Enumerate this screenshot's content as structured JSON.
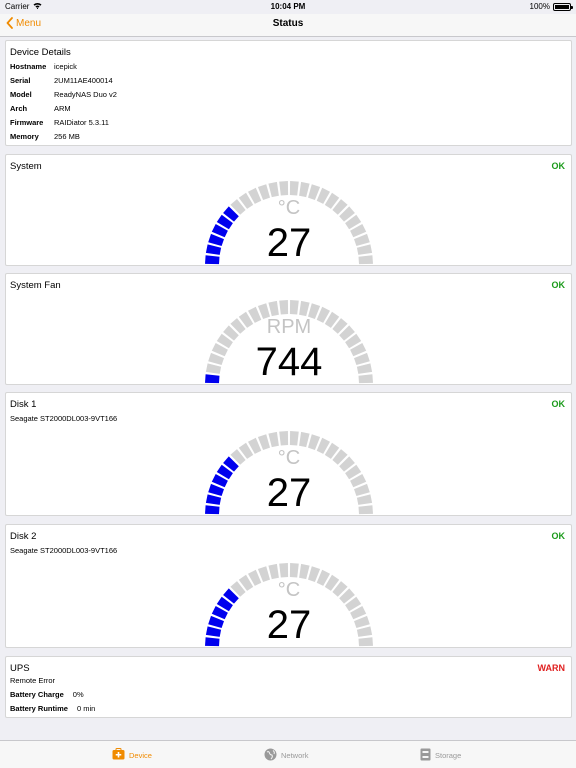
{
  "statusbar": {
    "carrier": "Carrier",
    "time": "10:04 PM",
    "battery": "100%"
  },
  "nav": {
    "back_label": "Menu",
    "title": "Status"
  },
  "device": {
    "title": "Device Details",
    "rows": [
      {
        "key": "Hostname",
        "value": "icepick"
      },
      {
        "key": "Serial",
        "value": "2UM11AE400014"
      },
      {
        "key": "Model",
        "value": "ReadyNAS Duo v2"
      },
      {
        "key": "Arch",
        "value": "ARM"
      },
      {
        "key": "Firmware",
        "value": "RAIDiator 5.3.11"
      },
      {
        "key": "Memory",
        "value": "256 MB"
      }
    ]
  },
  "gauges": [
    {
      "title": "System",
      "status": "OK",
      "subtitle": "",
      "unit": "°C",
      "value": "27",
      "lit_segments": 6,
      "total_segments": 24
    },
    {
      "title": "System Fan",
      "status": "OK",
      "subtitle": "",
      "unit": "RPM",
      "value": "744",
      "lit_segments": 1,
      "total_segments": 24
    },
    {
      "title": "Disk 1",
      "status": "OK",
      "subtitle": "Seagate ST2000DL003-9VT166",
      "unit": "°C",
      "value": "27",
      "lit_segments": 6,
      "total_segments": 24
    },
    {
      "title": "Disk 2",
      "status": "OK",
      "subtitle": "Seagate ST2000DL003-9VT166",
      "unit": "°C",
      "value": "27",
      "lit_segments": 6,
      "total_segments": 24
    }
  ],
  "ups": {
    "title": "UPS",
    "status": "WARN",
    "message": "Remote Error",
    "rows": [
      {
        "key": "Battery Charge",
        "value": "0%"
      },
      {
        "key": "Battery Runtime",
        "value": "0 min"
      }
    ]
  },
  "tabs": [
    {
      "label": "Device",
      "icon": "device-icon",
      "active": true
    },
    {
      "label": "Network",
      "icon": "globe-icon",
      "active": false
    },
    {
      "label": "Storage",
      "icon": "storage-icon",
      "active": false
    }
  ],
  "colors": {
    "accent": "#f08b00",
    "ok": "#1a9a1a",
    "warn": "#e02020",
    "gauge_lit": "#0000ee",
    "gauge_unlit": "#d3d3d3"
  }
}
